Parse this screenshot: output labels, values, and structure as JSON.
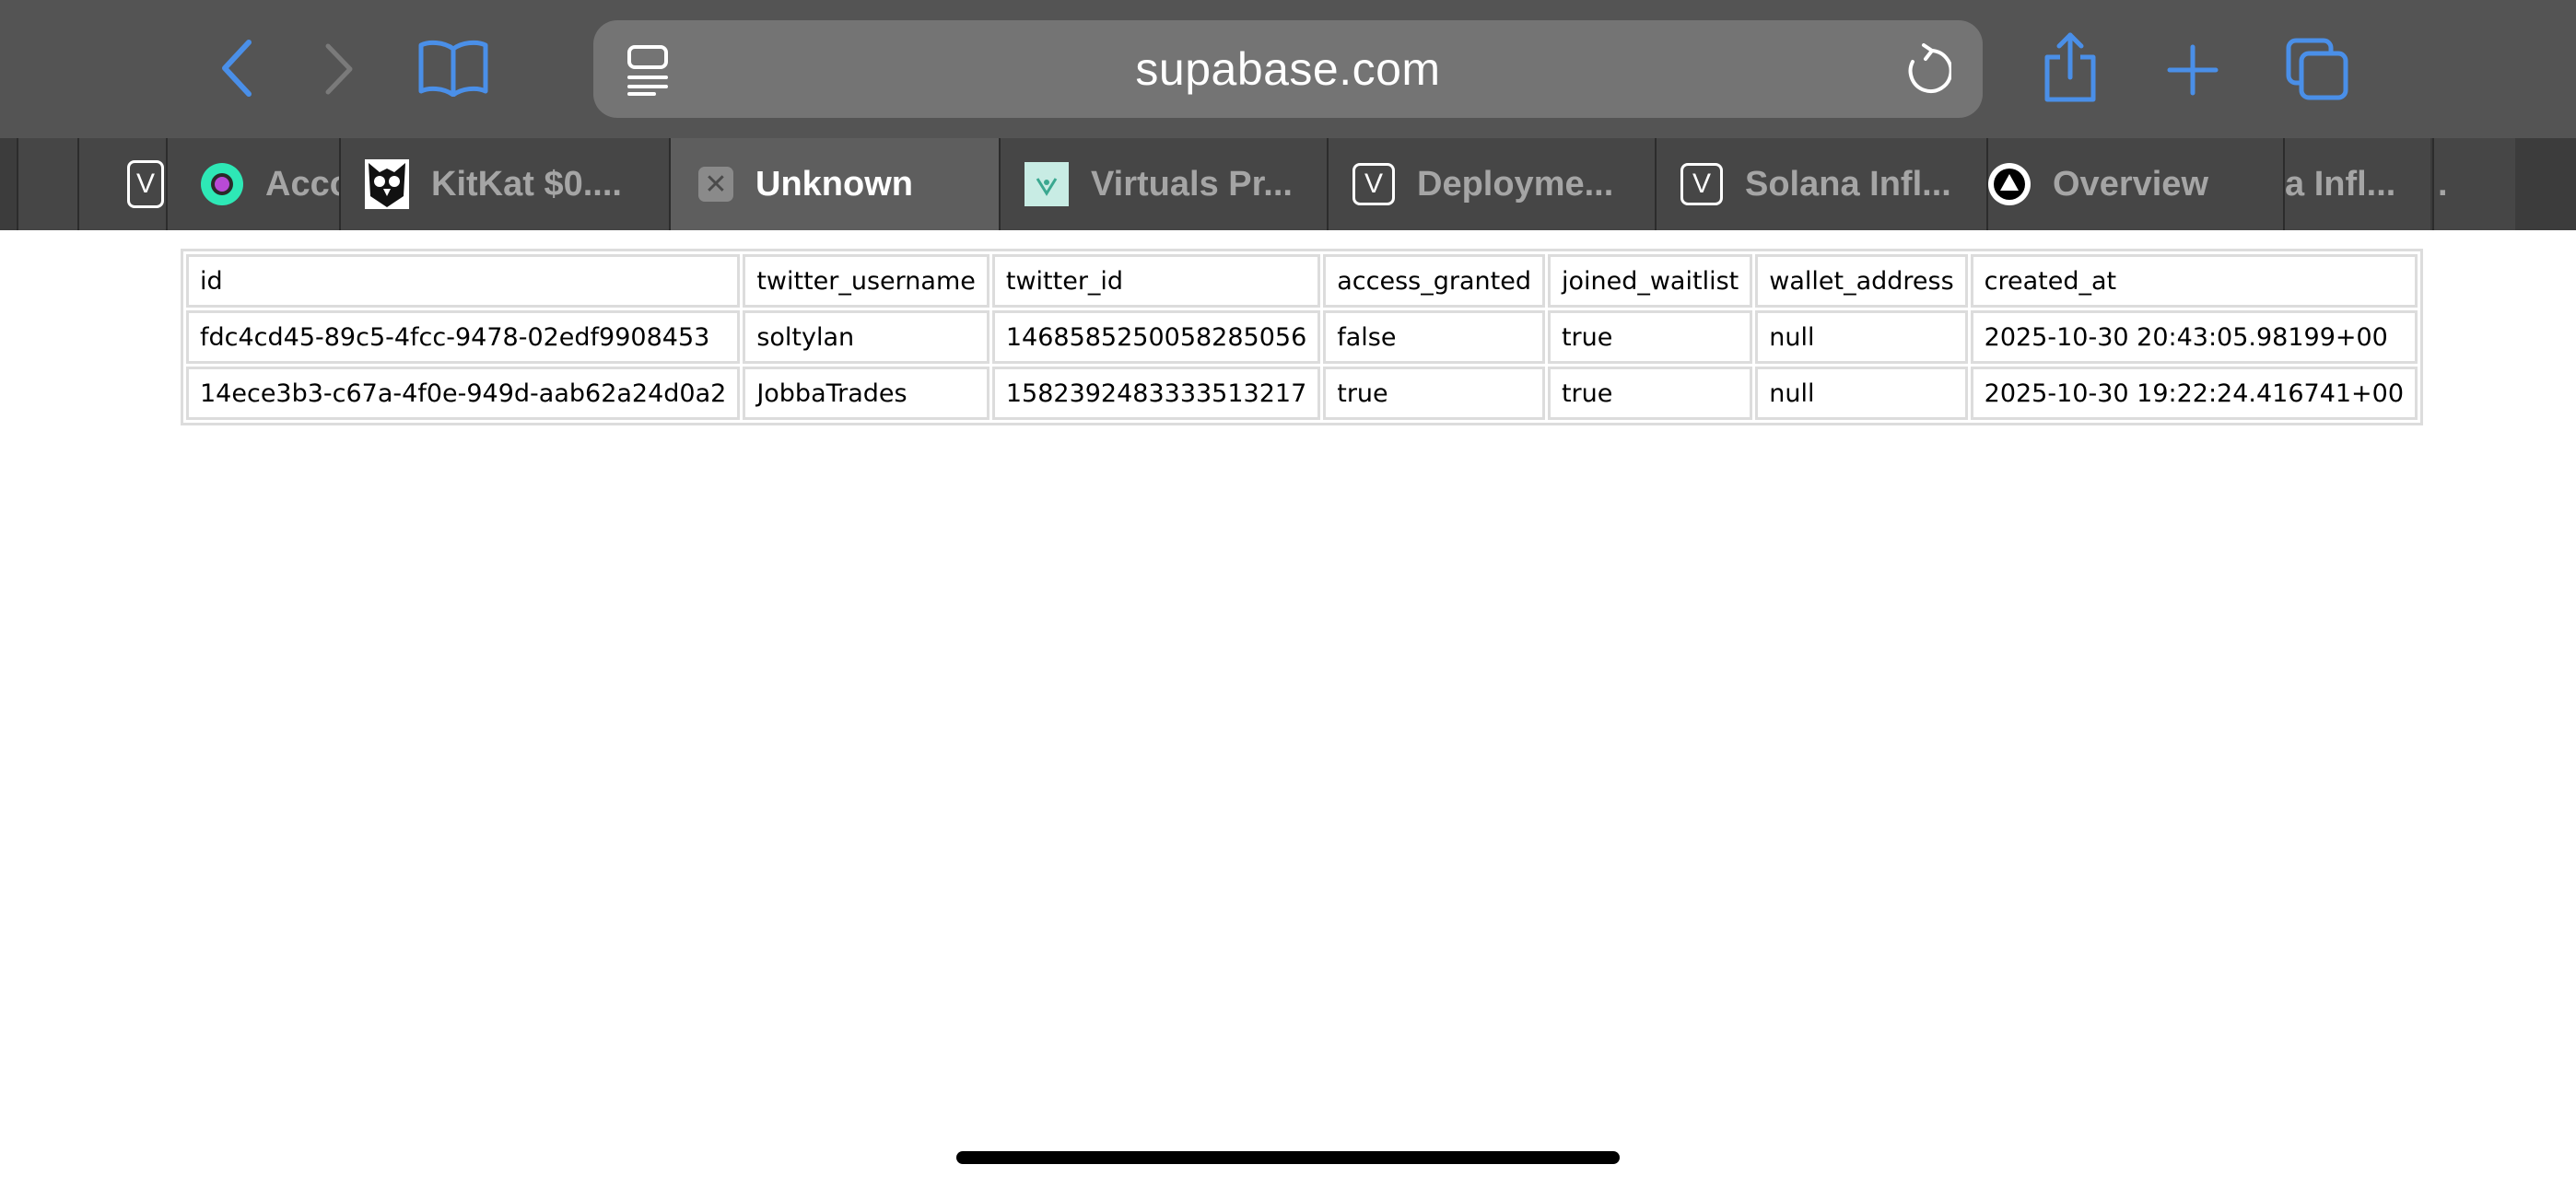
{
  "browser": {
    "url_display": "supabase.com",
    "accent_color": "#4a8fe8"
  },
  "tabs": [
    {
      "title": "",
      "favicon": "v-icon",
      "active": false
    },
    {
      "title": "Acco",
      "favicon": "accord-icon",
      "active": false
    },
    {
      "title": "KitKat $0....",
      "favicon": "owl-icon",
      "active": false
    },
    {
      "title": "Unknown",
      "favicon": "close-box-icon",
      "active": true
    },
    {
      "title": "Virtuals Pr...",
      "favicon": "virtuals-icon",
      "active": false
    },
    {
      "title": "Deployme...",
      "favicon": "v-icon",
      "active": false
    },
    {
      "title": "Solana Infl...",
      "favicon": "v-icon",
      "active": false
    },
    {
      "title": "Overview",
      "favicon": "triangle-icon",
      "active": false
    },
    {
      "title": "a Infl...",
      "favicon": "",
      "active": false
    },
    {
      "title": ".",
      "favicon": "",
      "active": false
    }
  ],
  "table": {
    "columns": [
      "id",
      "twitter_username",
      "twitter_id",
      "access_granted",
      "joined_waitlist",
      "wallet_address",
      "created_at"
    ],
    "rows": [
      [
        "fdc4cd45-89c5-4fcc-9478-02edf9908453",
        "soltylan",
        "1468585250058285056",
        "false",
        "true",
        "null",
        "2025-10-30 20:43:05.98199+00"
      ],
      [
        "14ece3b3-c67a-4f0e-949d-aab62a24d0a2",
        "JobbaTrades",
        "1582392483333513217",
        "true",
        "true",
        "null",
        "2025-10-30 19:22:24.416741+00"
      ]
    ]
  }
}
